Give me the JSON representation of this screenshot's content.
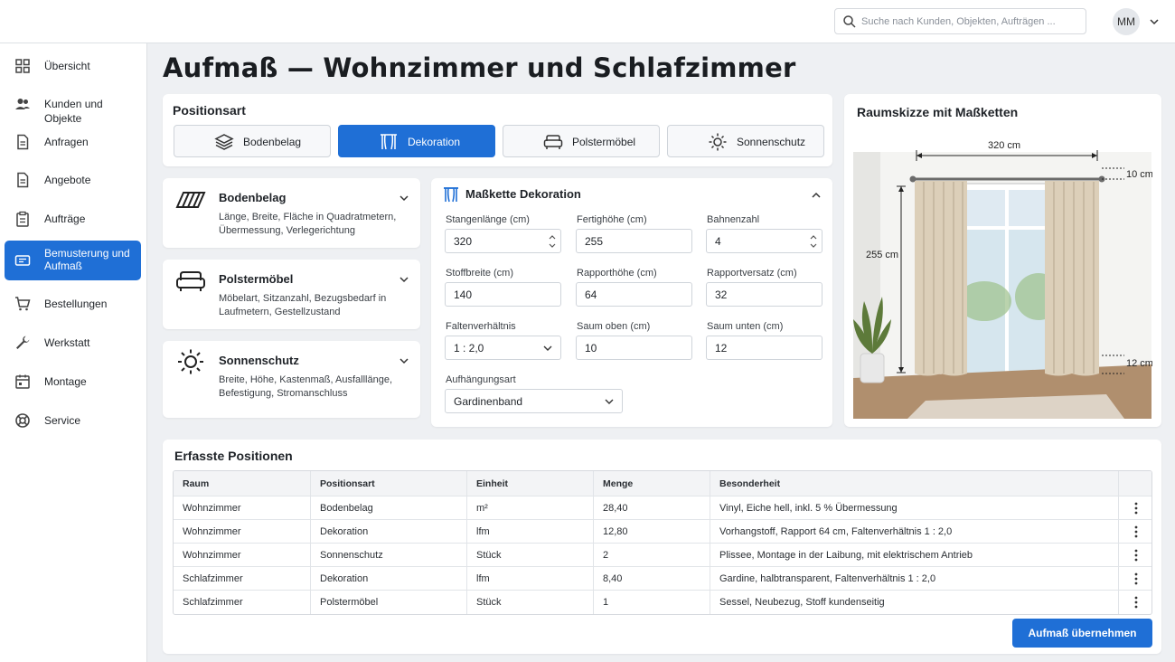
{
  "header": {
    "search_placeholder": "Suche nach Kunden, Objekten, Aufträgen ...",
    "user_initials": "MM"
  },
  "sidebar": {
    "items": [
      {
        "label": "Übersicht",
        "icon": "grid-icon"
      },
      {
        "label": "Kunden und Objekte",
        "icon": "users-icon"
      },
      {
        "label": "Anfragen",
        "icon": "document-icon"
      },
      {
        "label": "Angebote",
        "icon": "document-icon"
      },
      {
        "label": "Aufträge",
        "icon": "clipboard-icon"
      },
      {
        "label": "Bemusterung und Aufmaß",
        "icon": "swatch-icon",
        "active": true
      },
      {
        "label": "Bestellungen",
        "icon": "cart-icon"
      },
      {
        "label": "Werkstatt",
        "icon": "wrench-icon"
      },
      {
        "label": "Montage",
        "icon": "calendar-icon"
      },
      {
        "label": "Service",
        "icon": "lifebuoy-icon"
      }
    ]
  },
  "page": {
    "title": "Aufmaß — Wohnzimmer und Schlafzimmer"
  },
  "positionsart": {
    "title": "Positionsart",
    "options": [
      {
        "label": "Bodenbelag",
        "icon": "layers-icon"
      },
      {
        "label": "Dekoration",
        "icon": "curtain-icon",
        "active": true
      },
      {
        "label": "Polstermöbel",
        "icon": "sofa-icon"
      },
      {
        "label": "Sonnenschutz",
        "icon": "sun-icon"
      }
    ]
  },
  "categories": [
    {
      "title": "Bodenbelag",
      "desc": "Länge, Breite, Fläche in Quadratmetern, Übermessung, Verlegerichtung",
      "icon": "floor-icon"
    },
    {
      "title": "Polstermöbel",
      "desc": "Möbelart, Sitzanzahl, Bezugsbedarf in Laufmetern, Gestellzustand",
      "icon": "sofa-icon"
    },
    {
      "title": "Sonnenschutz",
      "desc": "Breite, Höhe, Kastenmaß, Ausfalllänge, Befestigung, Stromanschluss",
      "icon": "sun-icon"
    }
  ],
  "masskette": {
    "title": "Maßkette Dekoration",
    "fields": {
      "stangenlaenge": {
        "label": "Stangenlänge (cm)",
        "value": "320"
      },
      "fertighoehe": {
        "label": "Fertighöhe (cm)",
        "value": "255"
      },
      "bahnenzahl": {
        "label": "Bahnenzahl",
        "value": "4"
      },
      "stoffbreite": {
        "label": "Stoffbreite (cm)",
        "value": "140"
      },
      "rapporthoehe": {
        "label": "Rapporthöhe (cm)",
        "value": "64"
      },
      "rapportversatz": {
        "label": "Rapportversatz (cm)",
        "value": "32"
      },
      "faltenverhaeltnis": {
        "label": "Faltenverhältnis",
        "value": "1 : 2,0"
      },
      "saum_oben": {
        "label": "Saum oben (cm)",
        "value": "10"
      },
      "saum_unten": {
        "label": "Saum unten (cm)",
        "value": "12"
      },
      "aufhaengungsart": {
        "label": "Aufhängungsart",
        "value": "Gardinenband"
      }
    }
  },
  "sketch": {
    "title": "Raumskizze mit Maßketten",
    "dim_width": "320 cm",
    "dim_height": "255 cm",
    "dim_top": "10 cm",
    "dim_bottom": "12 cm",
    "colors": {
      "wall": "#f2f2f0",
      "floor": "#b08f6e",
      "curtain": "#d9cdb8",
      "sky": "#cfe3ee",
      "plant": "#5d7a3a"
    }
  },
  "table": {
    "title": "Erfasste Positionen",
    "headers": [
      "Raum",
      "Positionsart",
      "Einheit",
      "Menge",
      "Besonderheit"
    ],
    "rows": [
      [
        "Wohnzimmer",
        "Bodenbelag",
        "m²",
        "28,40",
        "Vinyl, Eiche hell, inkl. 5 % Übermessung"
      ],
      [
        "Wohnzimmer",
        "Dekoration",
        "lfm",
        "12,80",
        "Vorhangstoff, Rapport 64 cm, Faltenverhältnis 1 : 2,0"
      ],
      [
        "Wohnzimmer",
        "Sonnenschutz",
        "Stück",
        "2",
        "Plissee, Montage in der Laibung, mit elektrischem Antrieb"
      ],
      [
        "Schlafzimmer",
        "Dekoration",
        "lfm",
        "8,40",
        "Gardine, halbtransparent, Faltenverhältnis 1 : 2,0"
      ],
      [
        "Schlafzimmer",
        "Polstermöbel",
        "Stück",
        "1",
        "Sessel, Neubezug, Stoff kundenseitig"
      ]
    ],
    "apply_label": "Aufmaß übernehmen"
  },
  "accent_color": "#1f6fd6"
}
